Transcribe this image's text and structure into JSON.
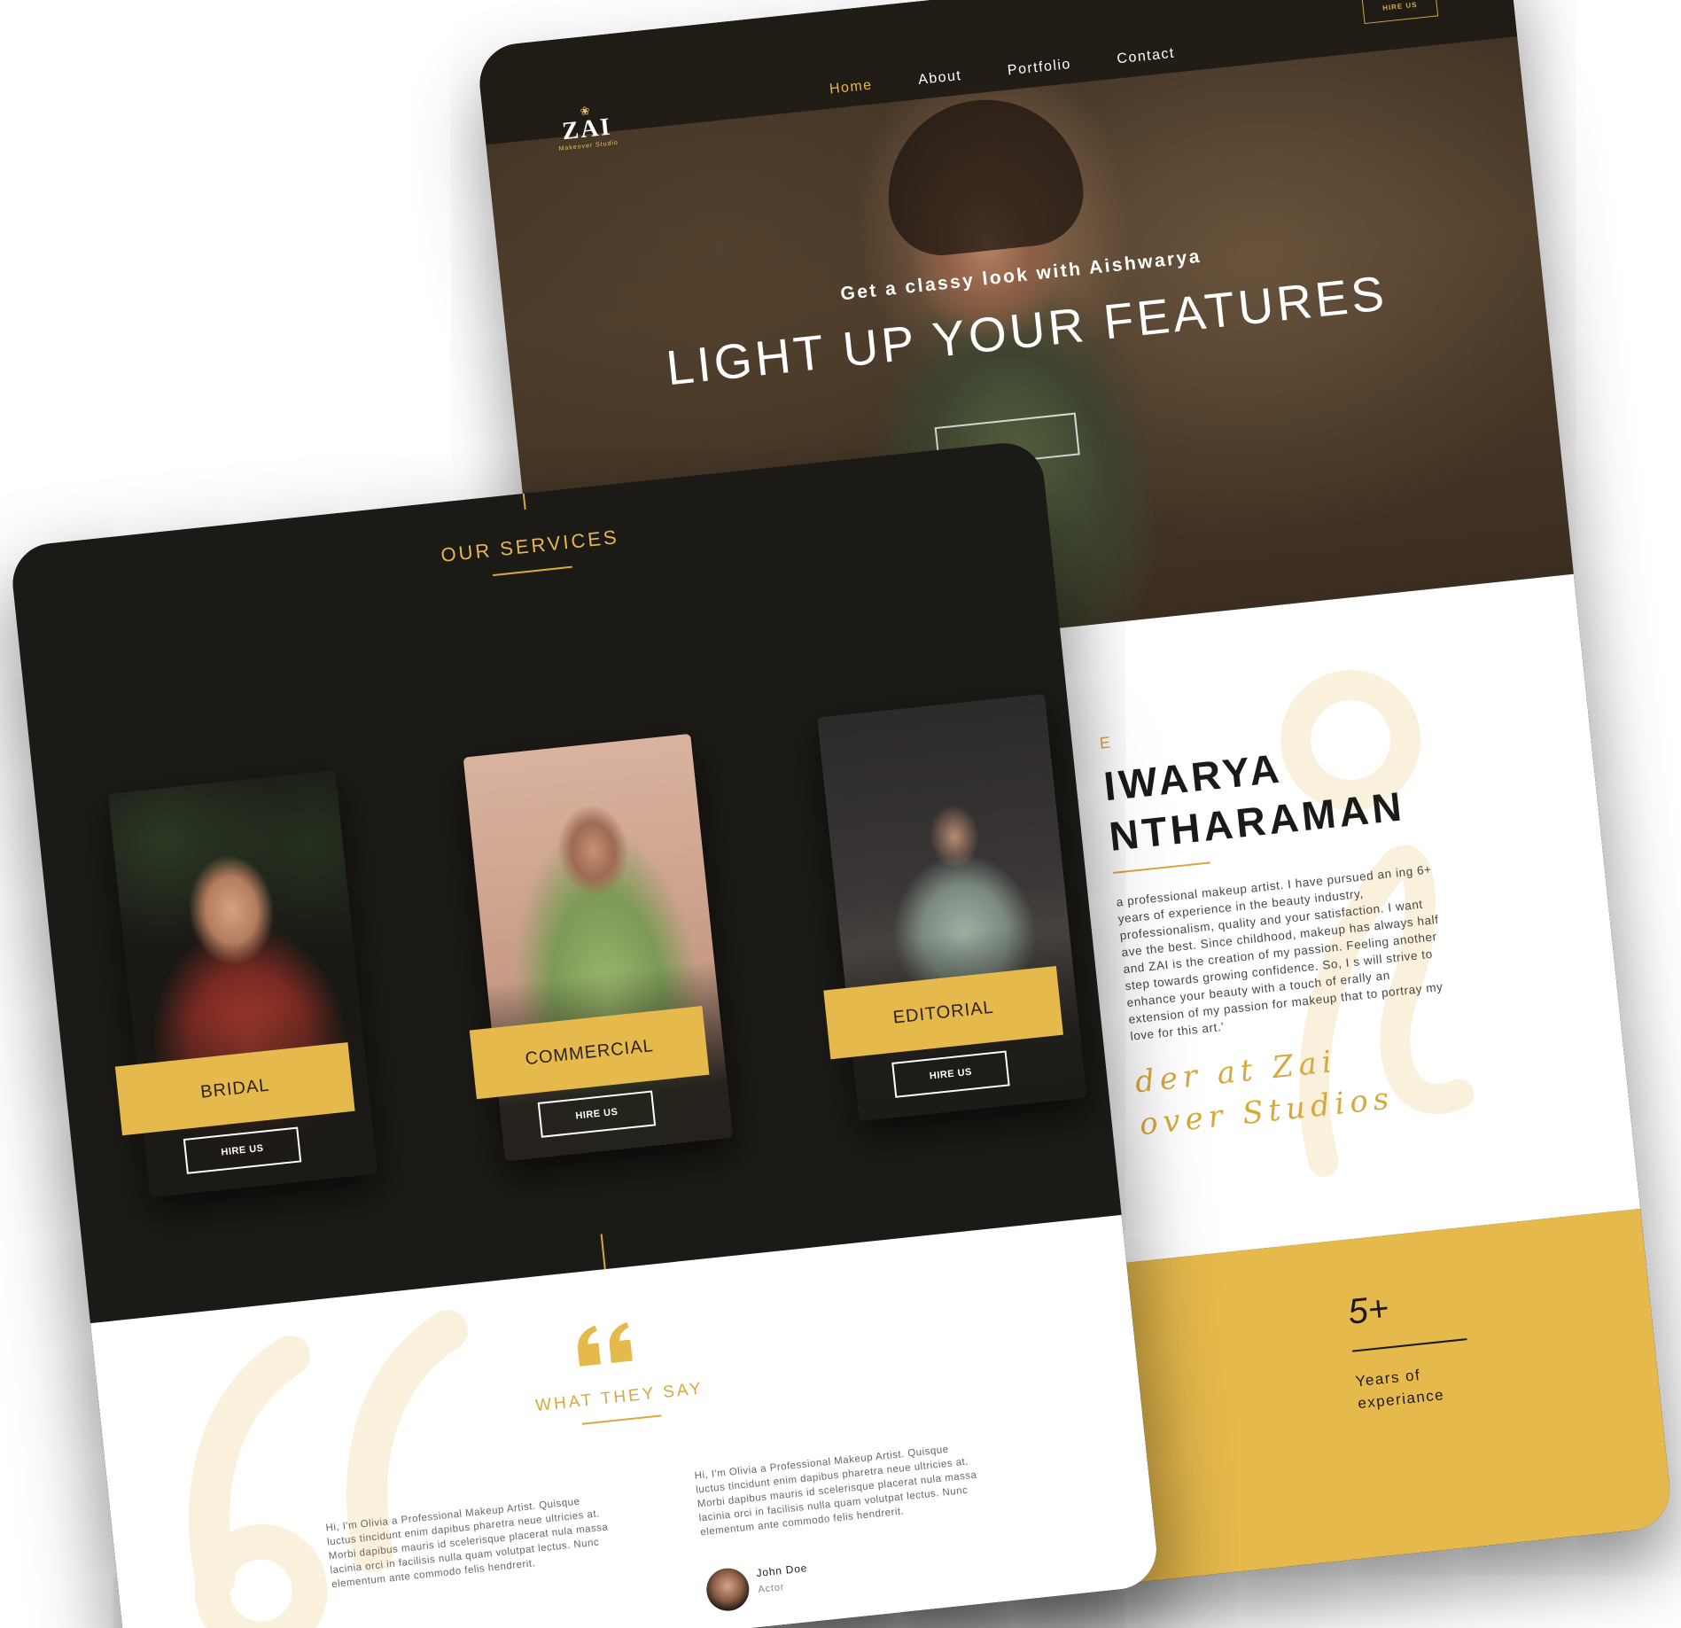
{
  "home": {
    "logo": {
      "mark": "ZAI",
      "tagline": "Makeover Studio"
    },
    "nav": [
      {
        "label": "Home",
        "active": true
      },
      {
        "label": "About",
        "active": false
      },
      {
        "label": "Portfolio",
        "active": false
      },
      {
        "label": "Contact",
        "active": false
      }
    ],
    "hire_button": "HIRE US",
    "hero": {
      "subtitle": "Get a classy look with Aishwarya",
      "title": "LIGHT UP YOUR FEATURES"
    },
    "about": {
      "eyebrow": "E",
      "name_line1": "IWARYA",
      "name_line2": "NTHARAMAN",
      "body": "a professional makeup artist. I have pursued an ing 6+ years of experience in the beauty industry, professionalism, quality and your satisfaction. I want ave the best. Since childhood, makeup has always half and ZAI is the creation of my passion. Feeling another step towards growing confidence. So, I s will strive to enhance your beauty with a touch of erally an extension of my passion for makeup that to portray my love for this art.'",
      "signature_line1": "der at Zai",
      "signature_line2": "over Studios"
    },
    "stats": {
      "value": "5+",
      "label": "Years of experiance"
    }
  },
  "services": {
    "title": "OUR SERVICES",
    "cards": [
      {
        "label": "BRIDAL",
        "button": "HIRE US"
      },
      {
        "label": "COMMERCIAL",
        "button": "HIRE US"
      },
      {
        "label": "EDITORIAL",
        "button": "HIRE US"
      }
    ]
  },
  "testimonials": {
    "title": "WHAT THEY SAY",
    "items": [
      {
        "text": "Hi, I'm Olivia a Professional Makeup Artist. Quisque luctus tincidunt enim dapibus pharetra neue ultricies at. Morbi dapibus mauris id scelerisque placerat nula massa lacinia orci in facilisis nulla quam volutpat lectus. Nunc elementum ante commodo felis hendrerit."
      },
      {
        "text": "Hi, I'm Olivia a Professional Makeup Artist. Quisque luctus tincidunt enim dapibus pharetra neue ultricies at. Morbi dapibus mauris id scelerisque placerat nula massa lacinia orci in facilisis nulla quam volutpat lectus. Nunc elementum ante commodo felis hendrerit.",
        "author": "John Doe",
        "role": "Actor"
      }
    ]
  },
  "colors": {
    "dark": "#1c1a16",
    "gold": "#e6b94c",
    "gold_text": "#d7a93c",
    "white": "#ffffff"
  }
}
